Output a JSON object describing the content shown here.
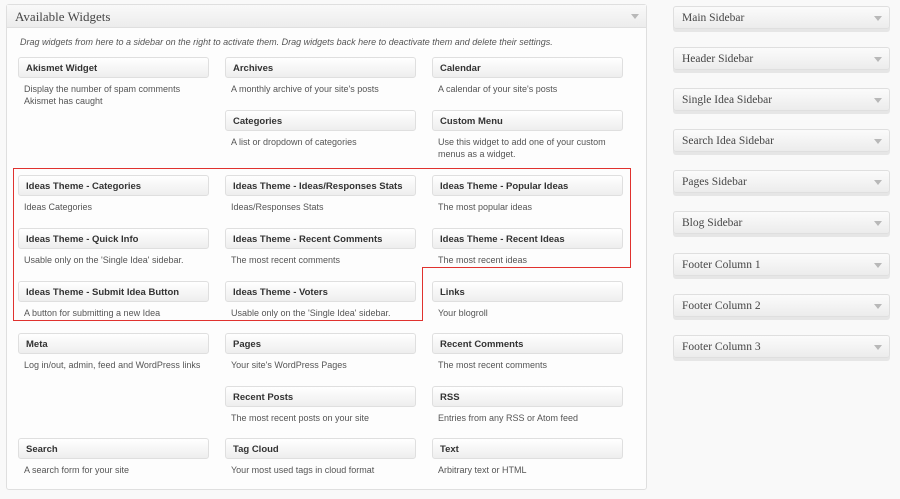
{
  "available": {
    "title": "Available Widgets",
    "description": "Drag widgets from here to a sidebar on the right to activate them. Drag widgets back here to deactivate them and delete their settings."
  },
  "widgets": [
    {
      "title": "Akismet Widget",
      "desc": "Display the number of spam comments Akismet has caught"
    },
    {
      "title": "Archives",
      "desc": "A monthly archive of your site's posts"
    },
    {
      "title": "Calendar",
      "desc": "A calendar of your site's posts"
    },
    {
      "title": "Categories",
      "desc": "A list or dropdown of categories"
    },
    {
      "title": "Custom Menu",
      "desc": "Use this widget to add one of your custom menus as a widget."
    },
    {
      "title": "Ideas Theme - Categories",
      "desc": "Ideas Categories"
    },
    {
      "title": "Ideas Theme - Ideas/Responses Stats",
      "desc": "Ideas/Responses Stats"
    },
    {
      "title": "Ideas Theme - Popular Ideas",
      "desc": "The most popular ideas"
    },
    {
      "title": "Ideas Theme - Quick Info",
      "desc": "Usable only on the 'Single Idea' sidebar."
    },
    {
      "title": "Ideas Theme - Recent Comments",
      "desc": "The most recent comments"
    },
    {
      "title": "Ideas Theme - Recent Ideas",
      "desc": "The most recent ideas"
    },
    {
      "title": "Ideas Theme - Submit Idea Button",
      "desc": "A button for submitting a new Idea"
    },
    {
      "title": "Ideas Theme - Voters",
      "desc": "Usable only on the 'Single Idea' sidebar."
    },
    {
      "title": "Links",
      "desc": "Your blogroll"
    },
    {
      "title": "Meta",
      "desc": "Log in/out, admin, feed and WordPress links"
    },
    {
      "title": "Pages",
      "desc": "Your site's WordPress Pages"
    },
    {
      "title": "Recent Comments",
      "desc": "The most recent comments"
    },
    {
      "title": "Recent Posts",
      "desc": "The most recent posts on your site"
    },
    {
      "title": "RSS",
      "desc": "Entries from any RSS or Atom feed"
    },
    {
      "title": "Search",
      "desc": "A search form for your site"
    },
    {
      "title": "Tag Cloud",
      "desc": "Your most used tags in cloud format"
    },
    {
      "title": "Text",
      "desc": "Arbitrary text or HTML"
    }
  ],
  "sidebars": [
    {
      "label": "Main Sidebar"
    },
    {
      "label": "Header Sidebar"
    },
    {
      "label": "Single Idea Sidebar"
    },
    {
      "label": "Search Idea Sidebar"
    },
    {
      "label": "Pages Sidebar"
    },
    {
      "label": "Blog Sidebar"
    },
    {
      "label": "Footer Column 1"
    },
    {
      "label": "Footer Column 2"
    },
    {
      "label": "Footer Column 3"
    }
  ],
  "colors": {
    "highlight": "#e0322f",
    "border": "#dfdfdf"
  }
}
